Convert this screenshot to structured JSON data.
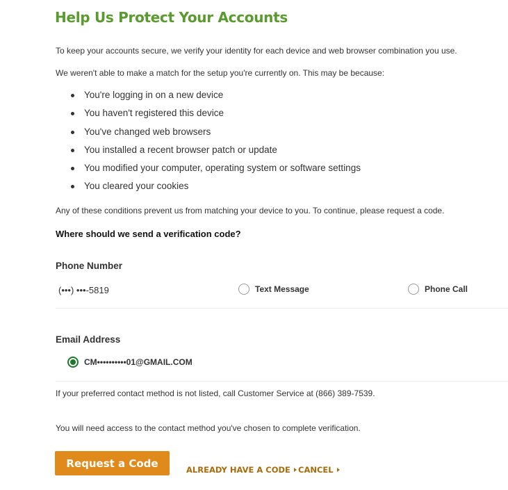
{
  "page": {
    "title": "Help Us Protect Your Accounts",
    "intro": "To keep your accounts secure, we verify your identity for each device and web browser combination you use.",
    "mismatch": "We weren't able to make a match for the setup you're currently on. This may be because:",
    "reasons": [
      "You're logging in on a new device",
      "You haven't registered this device",
      "You've changed web browsers",
      "You installed a recent browser patch or update",
      "You modified your computer, operating system or software settings",
      "You cleared your cookies"
    ],
    "conditions": "Any of these conditions prevent us from matching your device to you. To continue, please request a code.",
    "question": "Where should we send a verification code?"
  },
  "phone": {
    "label": "Phone Number",
    "masked_number": "(•••) •••-5819",
    "options": [
      {
        "label": "Text Message",
        "checked": false
      },
      {
        "label": "Phone Call",
        "checked": false
      }
    ]
  },
  "email": {
    "label": "Email Address",
    "masked_address": "CM••••••••••01@GMAIL.COM",
    "checked": true
  },
  "notes": {
    "not_listed": "If your preferred contact method is not listed, call Customer Service at (866) 389-7539.",
    "access": "You will need access to the contact method you've chosen to complete verification."
  },
  "actions": {
    "request_code": "Request a Code",
    "already_have_code": "ALREADY HAVE A CODE",
    "cancel": "CANCEL"
  },
  "colors": {
    "title_green": "#5a9a2e",
    "button_orange": "#e08a1c",
    "link_orange": "#a86c0a",
    "radio_green": "#1d7a2a"
  }
}
